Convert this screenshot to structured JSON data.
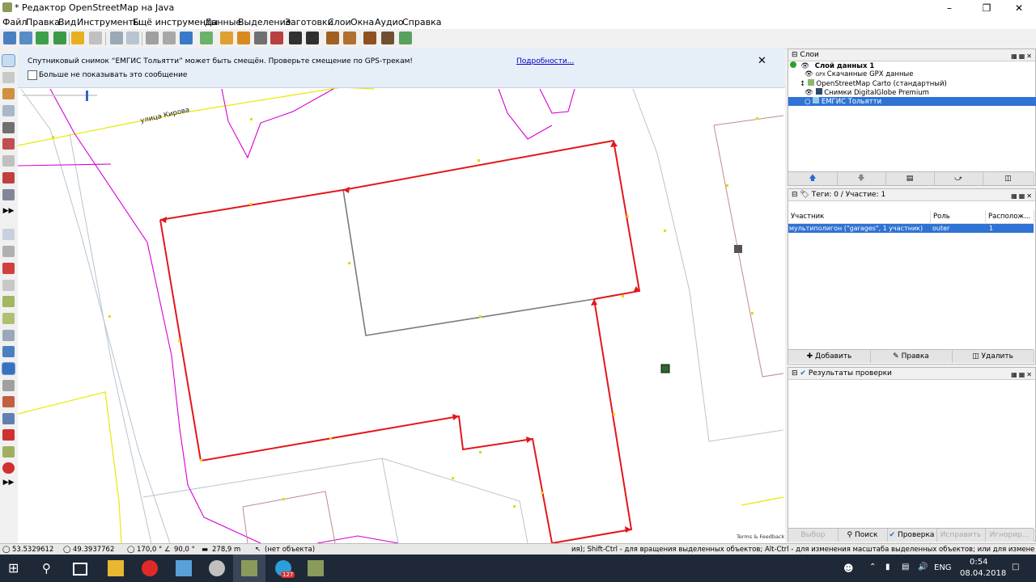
{
  "window": {
    "title": "* Редактор OpenStreetMap на Java"
  },
  "menu": [
    "Файл",
    "Правка",
    "Вид",
    "Инструменты",
    "Ещё инструменты",
    "Данные",
    "Выделение",
    "Заготовки",
    "Слои",
    "Окна",
    "Аудио",
    "Справка"
  ],
  "banner": {
    "message": "Спутниковый снимок “ЕМГИС Тольятти” может быть смещён. Проверьте смещение по GPS-трекам!",
    "link": "Подробности...",
    "checkbox_label": "Больше не показывать это сообщение"
  },
  "map": {
    "street_label": "улица Кирова",
    "attribution": "Terms & Feedback"
  },
  "layers_panel": {
    "title": "Слои",
    "items": [
      {
        "label": "Слой данных 1",
        "bold": true
      },
      {
        "label": "Скачанные GPX данные"
      },
      {
        "label": "OpenStreetMap Carto (стандартный)"
      },
      {
        "label": "Снимки DigitalGlobe Premium"
      },
      {
        "label": "ЕМГИС Тольятти",
        "selected": true
      }
    ]
  },
  "tags_panel": {
    "title": "Теги: 0 / Участие: 1",
    "columns": [
      "Участник",
      "Роль",
      "Располож..."
    ],
    "rows": [
      {
        "member": "мультиполигон (\"garages\", 1 участник)",
        "role": "outer",
        "pos": "1"
      }
    ],
    "buttons": {
      "add": "Добавить",
      "edit": "Правка",
      "delete": "Удалить"
    }
  },
  "validation_panel": {
    "title": "Результаты проверки",
    "buttons": {
      "select": "Выбор",
      "search": "Поиск",
      "check": "Проверка",
      "fix": "Исправить",
      "ignore": "Игнорир..."
    }
  },
  "status": {
    "lat": "53.5329612",
    "lon": "49.3937762",
    "heading": "170,0 °",
    "angle": "90,0 °",
    "length": "278,9 m",
    "object": "(нет объекта)",
    "hint": "ия); Shift-Ctrl - для вращения выделенных объектов; Alt-Ctrl - для изменения масштаба выделенных объектов; или для изменения"
  },
  "taskbar": {
    "badge": "127",
    "lang": "ENG",
    "time": "0:54",
    "date": "08.04.2018"
  },
  "colors": {
    "selected_way": "#e3161b",
    "unselected_way": "#7a7a7a",
    "landuse": "#d600d6",
    "road": "#e8e800",
    "selection_blue": "#2f73d4"
  }
}
